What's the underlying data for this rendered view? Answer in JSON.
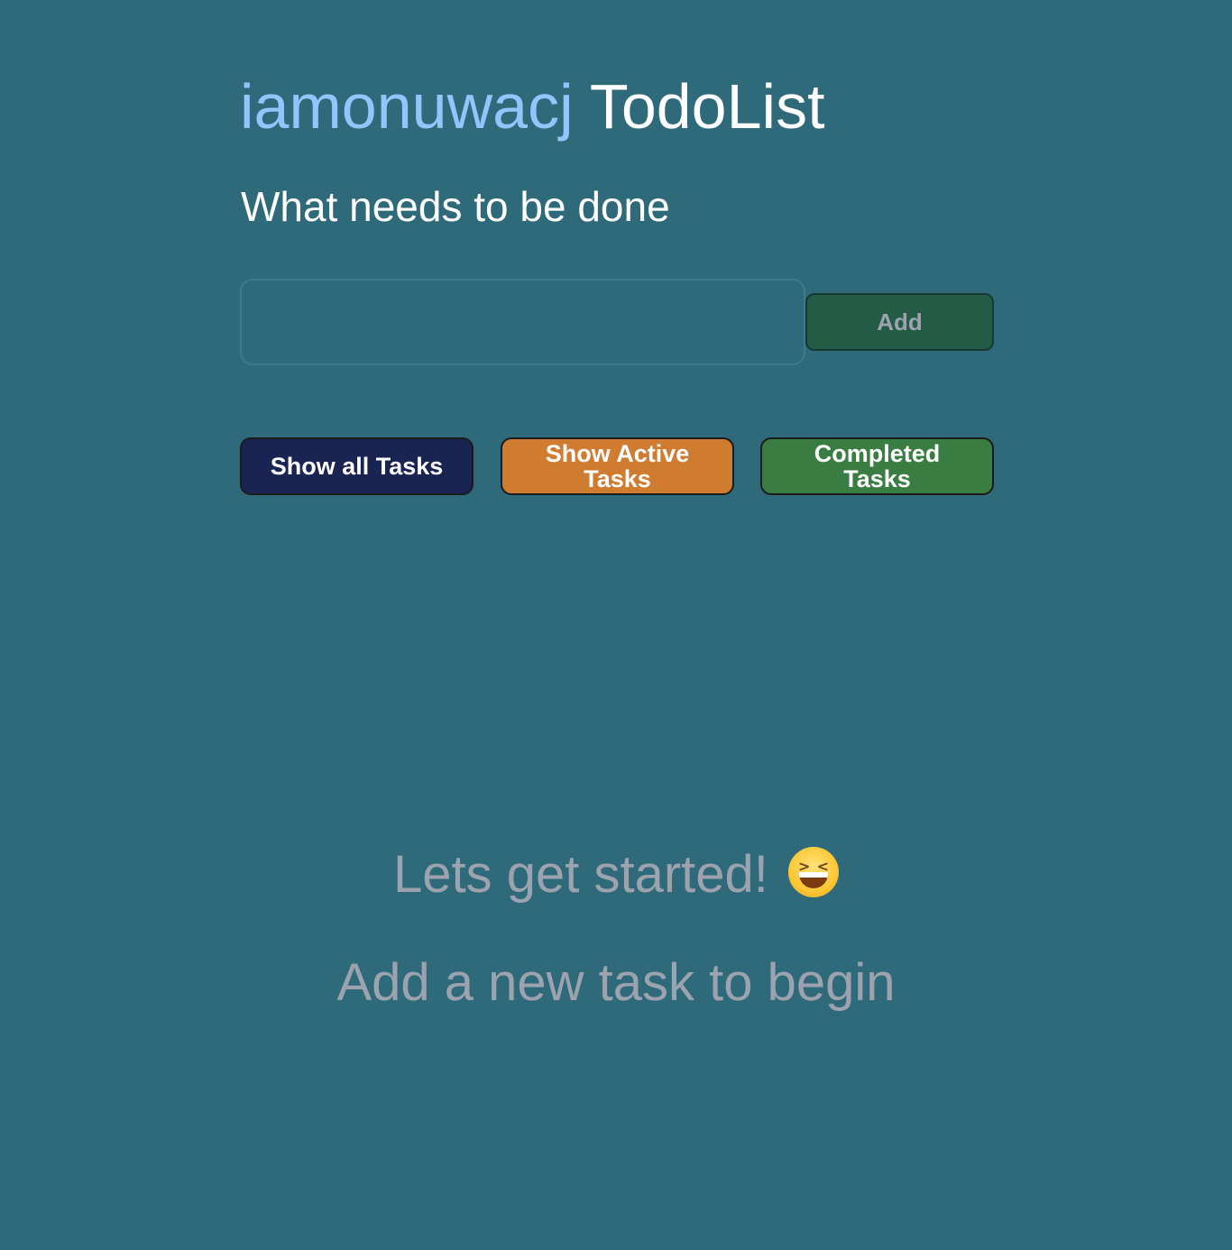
{
  "header": {
    "brand": "iamonuwacj",
    "app_name": "TodoList",
    "subtitle": "What needs to be done"
  },
  "task_form": {
    "input_value": "",
    "input_placeholder": "",
    "add_label": "Add"
  },
  "filters": {
    "all_label": "Show all Tasks",
    "active_label": "Show Active Tasks",
    "completed_label": "Completed Tasks"
  },
  "empty_state": {
    "line1": "Lets get started!",
    "emoji_icon": "grinning-squinting-face-icon",
    "line2": "Add a new task to begin"
  },
  "colors": {
    "background": "#2f6a7b",
    "brand": "#93c5fd",
    "add_button": "#245b47",
    "all_button": "#1a2453",
    "active_button": "#cf7b30",
    "completed_button": "#3a7d43",
    "muted_text": "#9ca3af"
  }
}
